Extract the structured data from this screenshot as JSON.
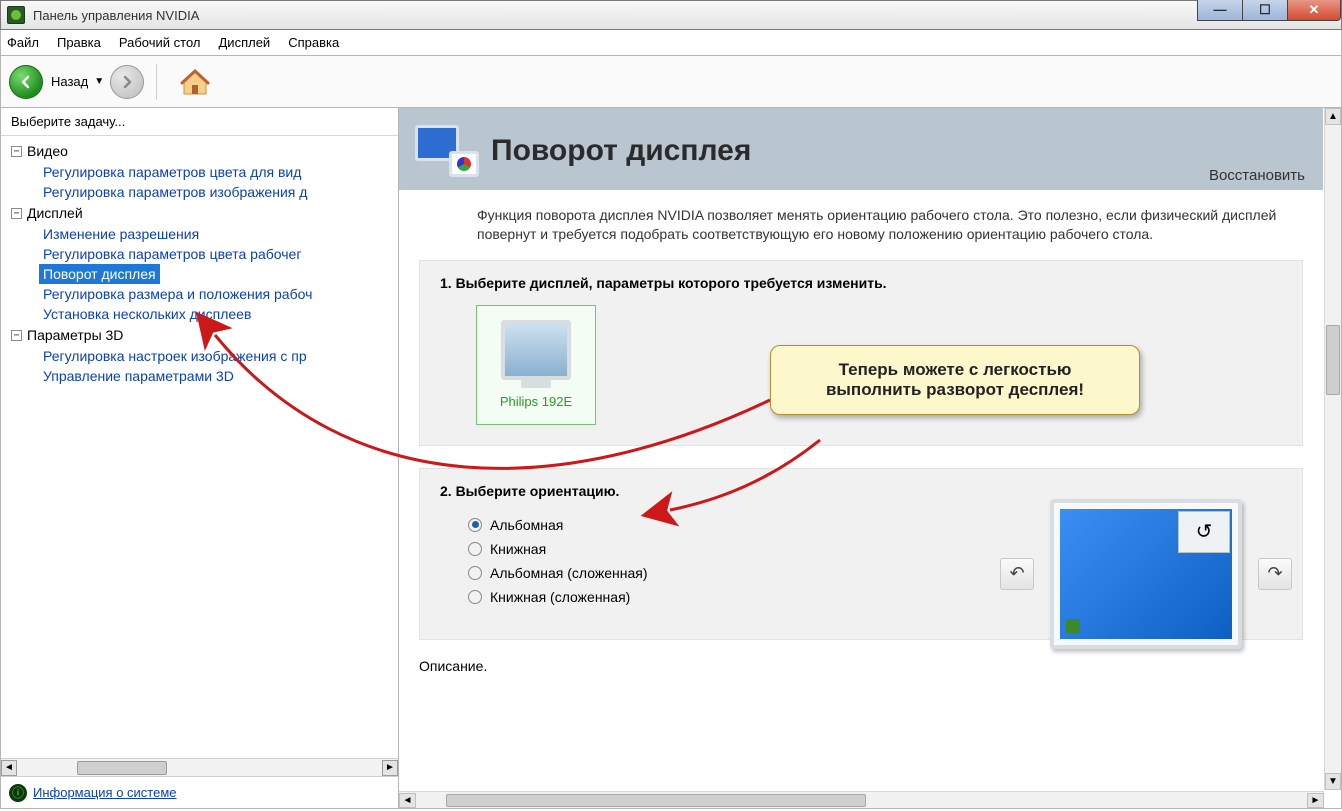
{
  "window": {
    "title": "Панель управления NVIDIA"
  },
  "menu": {
    "file": "Файл",
    "edit": "Правка",
    "desktop": "Рабочий стол",
    "display": "Дисплей",
    "help": "Справка"
  },
  "toolbar": {
    "back": "Назад"
  },
  "sidebar": {
    "header": "Выберите задачу...",
    "cat_video": "Видео",
    "video_items": {
      "a": "Регулировка параметров цвета для вид",
      "b": "Регулировка параметров изображения д"
    },
    "cat_display": "Дисплей",
    "display_items": {
      "a": "Изменение разрешения",
      "b": "Регулировка параметров цвета рабочег",
      "c": "Поворот дисплея",
      "d": "Регулировка размера и положения рабоч",
      "e": "Установка нескольких дисплеев"
    },
    "cat_3d": "Параметры 3D",
    "d3_items": {
      "a": "Регулировка настроек изображения с пр",
      "b": "Управление параметрами 3D"
    },
    "sysinfo": "Информация о системе"
  },
  "page": {
    "title": "Поворот дисплея",
    "restore": "Восстановить",
    "description": "Функция поворота дисплея NVIDIA позволяет менять ориентацию рабочего стола. Это полезно, если физический дисплей повернут и требуется подобрать соответствующую его новому положению ориентацию рабочего стола.",
    "step1": "1. Выберите дисплей, параметры которого требуется изменить.",
    "display_name": "Philips 192E",
    "step2": "2. Выберите ориентацию.",
    "orientations": {
      "landscape": "Альбомная",
      "portrait": "Книжная",
      "landscape_flipped": "Альбомная (сложенная)",
      "portrait_flipped": "Книжная (сложенная)"
    },
    "desc_label": "Описание."
  },
  "callout": {
    "text": "Теперь можете с легкостью выполнить разворот десплея!"
  }
}
